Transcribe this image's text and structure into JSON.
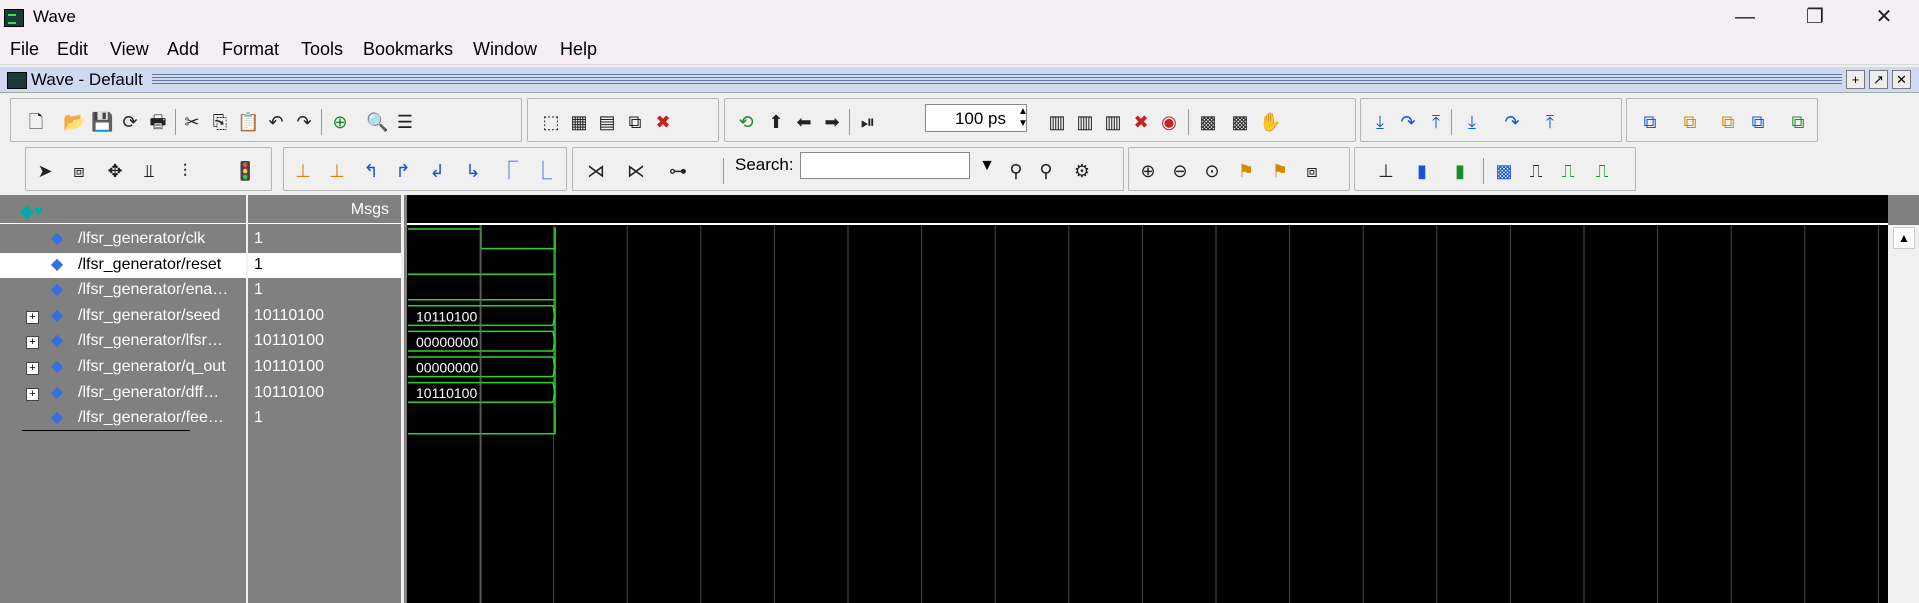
{
  "window": {
    "title": "Wave"
  },
  "menu": [
    "File",
    "Edit",
    "View",
    "Add",
    "Format",
    "Tools",
    "Bookmarks",
    "Window",
    "Help"
  ],
  "wave_window": {
    "title": "Wave - Default"
  },
  "toolbar": {
    "time_value": "100 ps",
    "search_label": "Search:",
    "search_value": ""
  },
  "panes": {
    "msgs_header": "Msgs"
  },
  "signals": [
    {
      "name": "/lfsr_generator/clk",
      "value": "1",
      "type": "logic",
      "expandable": false
    },
    {
      "name": "/lfsr_generator/reset",
      "value": "1",
      "type": "logic",
      "expandable": false,
      "selected": true
    },
    {
      "name": "/lfsr_generator/ena…",
      "value": "1",
      "type": "logic",
      "expandable": false
    },
    {
      "name": "/lfsr_generator/seed",
      "value": "10110100",
      "type": "bus",
      "expandable": true,
      "wave_value": "10110100"
    },
    {
      "name": "/lfsr_generator/lfsr…",
      "value": "10110100",
      "type": "bus",
      "expandable": true,
      "wave_value": "00000000"
    },
    {
      "name": "/lfsr_generator/q_out",
      "value": "10110100",
      "type": "bus",
      "expandable": true,
      "wave_value": "00000000"
    },
    {
      "name": "/lfsr_generator/dff…",
      "value": "10110100",
      "type": "bus",
      "expandable": true,
      "wave_value": "10110100"
    },
    {
      "name": "/lfsr_generator/fee…",
      "value": "1",
      "type": "logic",
      "expandable": false
    }
  ],
  "colors": {
    "wave": "#2ad42a",
    "background": "#000000",
    "pane": "#808080"
  }
}
